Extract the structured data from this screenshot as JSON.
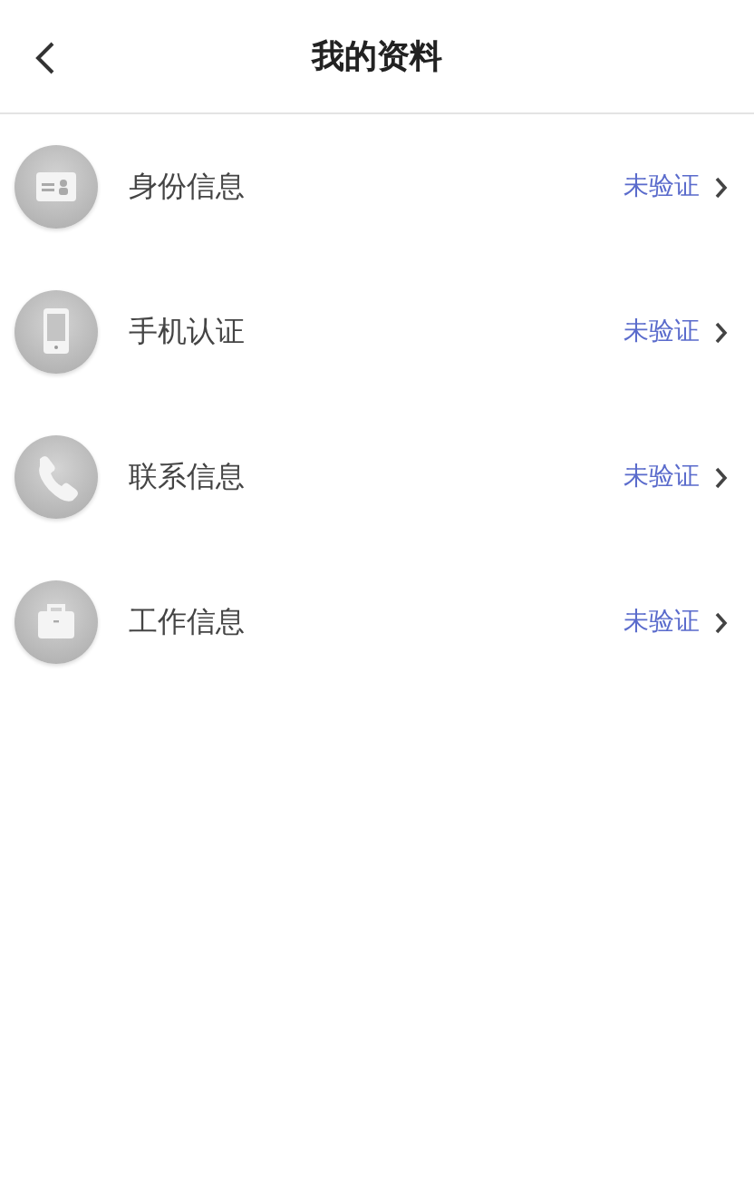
{
  "header": {
    "title": "我的资料"
  },
  "items": [
    {
      "kind": "id-card",
      "label": "身份信息",
      "status": "未验证"
    },
    {
      "kind": "mobile",
      "label": "手机认证",
      "status": "未验证"
    },
    {
      "kind": "handset",
      "label": "联系信息",
      "status": "未验证"
    },
    {
      "kind": "briefcase",
      "label": "工作信息",
      "status": "未验证"
    }
  ]
}
